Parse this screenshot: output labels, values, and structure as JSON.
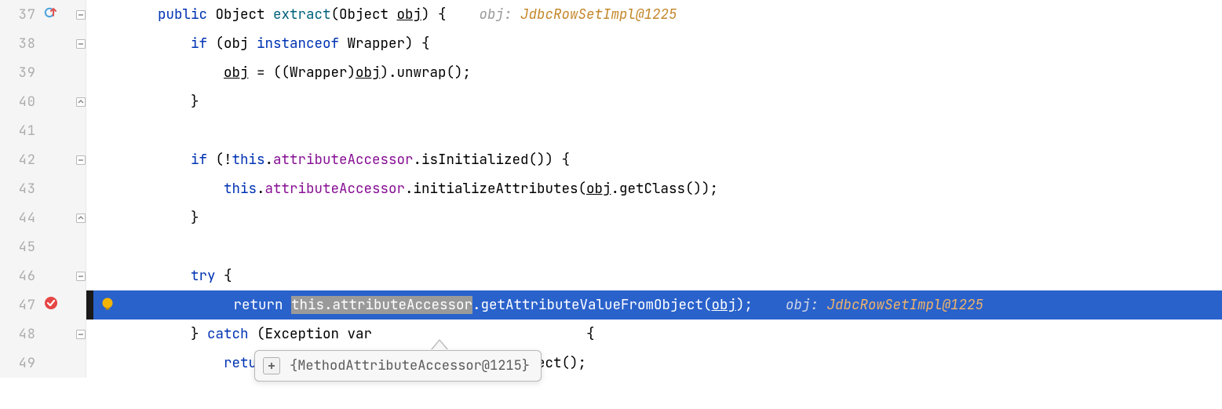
{
  "lines": {
    "l37": {
      "num": "37",
      "kw_public": "public",
      "type_object": "Object",
      "method_name": "extract",
      "param_type": "Object",
      "param_name": "obj",
      "open": ") {",
      "hint_label": "obj:",
      "hint_value": " JdbcRowSetImpl@1225"
    },
    "l38": {
      "num": "38",
      "kw_if": "if",
      "var": "obj",
      "kw_instanceof": "instanceof",
      "type": "Wrapper",
      "close": ") {"
    },
    "l39": {
      "num": "39",
      "var": "obj",
      "assign": " = ((Wrapper)",
      "var2": "obj",
      "call": ").unwrap();"
    },
    "l40": {
      "num": "40",
      "brace": "}"
    },
    "l41": {
      "num": "41"
    },
    "l42": {
      "num": "42",
      "kw_if": "if",
      "neg": " (!",
      "kw_this": "this",
      "dot1": ".",
      "field": "attributeAccessor",
      "dot2": ".",
      "method": "isInitialized",
      "close": "()) {"
    },
    "l43": {
      "num": "43",
      "kw_this": "this",
      "dot1": ".",
      "field": "attributeAccessor",
      "dot2": ".",
      "method": "initializeAttributes",
      "open": "(",
      "var": "obj",
      "call2": ".getClass());"
    },
    "l44": {
      "num": "44",
      "brace": "}"
    },
    "l45": {
      "num": "45"
    },
    "l46": {
      "num": "46",
      "kw_try": "try",
      "brace": " {"
    },
    "l47": {
      "num": "47",
      "kw_return": "return",
      "sp": " ",
      "sel": "this.attributeAccessor",
      "dot": ".",
      "method": "getAttributeValueFromObject",
      "open": "(",
      "var": "obj",
      "close": ");",
      "hint_label": "obj:",
      "hint_value": " JdbcRowSetImpl@1225"
    },
    "l48": {
      "num": "48",
      "brace1": "} ",
      "kw_catch": "catch",
      "rest": " (Exception var",
      "tail": "   {"
    },
    "l49": {
      "num": "49",
      "ret": "retu",
      "tail": "Object();"
    }
  },
  "tooltip": {
    "text": "{MethodAttributeAccessor@1215}"
  },
  "icons": {
    "override": "override-icon",
    "breakpoint": "breakpoint-icon",
    "bulb": "intention-bulb-icon",
    "fold_minus": "fold-minus-icon",
    "fold_up": "fold-up-icon",
    "plus": "expand-plus-icon"
  }
}
